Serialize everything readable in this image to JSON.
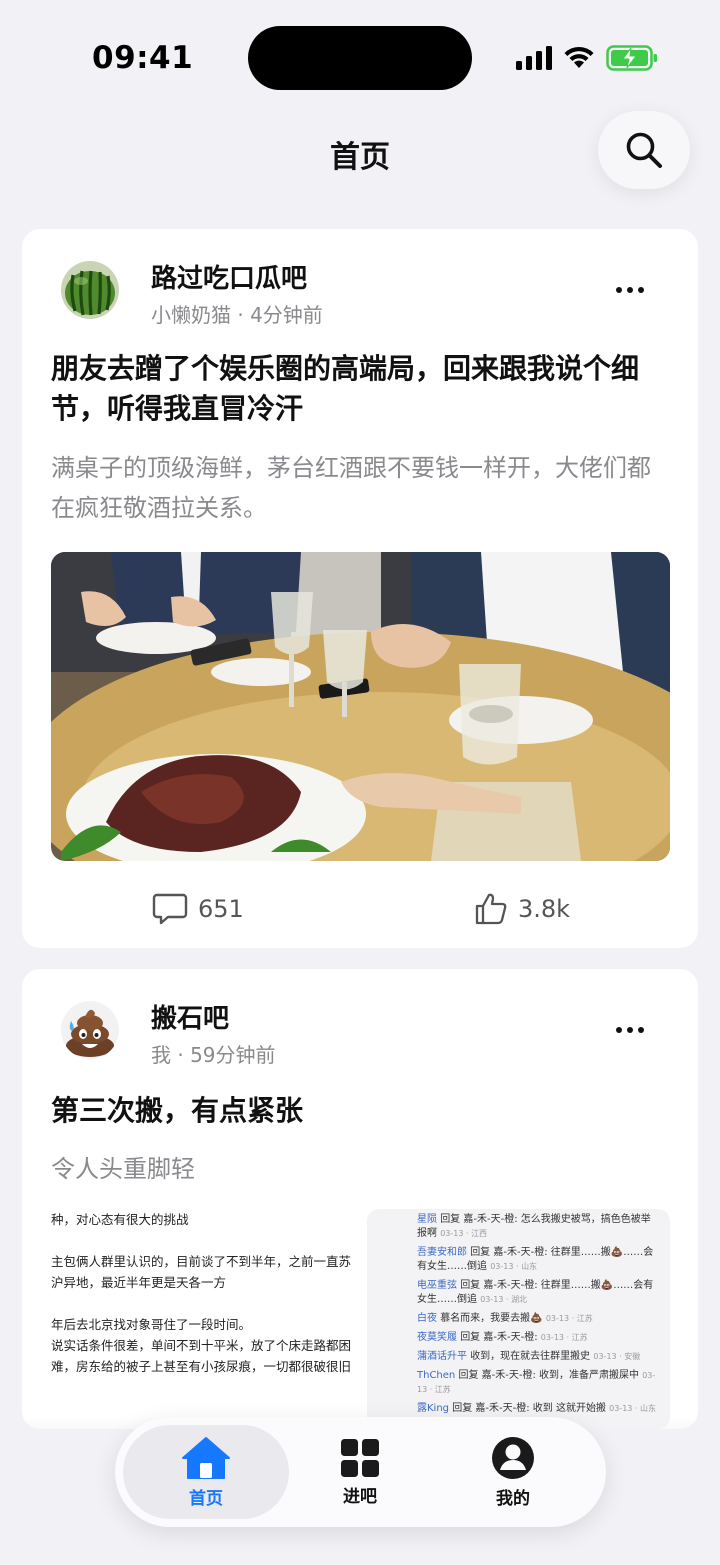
{
  "status_bar": {
    "time": "09:41"
  },
  "header": {
    "title": "首页"
  },
  "posts": [
    {
      "forum": "路过吃口瓜吧",
      "author": "小懒奶猫",
      "time": "4分钟前",
      "title": "朋友去蹭了个娱乐圈的高端局，回来跟我说个细节，听得我直冒冷汗",
      "excerpt": "满桌子的顶级海鲜，茅台红酒跟不要钱一样开，大佬们都在疯狂敬酒拉关系。",
      "comments": "651",
      "likes": "3.8k"
    },
    {
      "forum": "搬石吧",
      "author": "我",
      "time": "59分钟前",
      "title": "第三次搬，有点紧张",
      "excerpt": "令人头重脚轻",
      "image_left_text": [
        "种，对心态有很大的挑战",
        "主包俩人群里认识的，目前谈了不到半年，之前一直苏沪异地，最近半年更是天各一方",
        "年后去北京找对象哥住了一段时间。\n说实话条件很差，单间不到十平米，放了个床走路都困难，房东给的被子上甚至有小孩尿痕，一切都很破很旧"
      ],
      "image_right_comments": [
        {
          "user": "星陨",
          "text": "回复 嘉-禾-天-橙: 怎么我搬史被骂，搞色色被举报啊",
          "meta": "03-13 · 江西"
        },
        {
          "user": "吾妻安和郎",
          "text": "回复 嘉-禾-天-橙: 往群里……搬💩……会有女生……倒追",
          "meta": "03-13 · 山东"
        },
        {
          "user": "电巫重弦",
          "text": "回复 嘉-禾-天-橙: 往群里……搬💩……会有女生……倒追",
          "meta": "03-13 · 湖北"
        },
        {
          "user": "白夜",
          "text": "慕名而来，我要去搬💩",
          "meta": "03-13 · 江苏"
        },
        {
          "user": "夜莫笑履",
          "text": "回复 嘉-禾-天-橙:",
          "meta": "03-13 · 江苏"
        },
        {
          "user": "蒲酒话升平",
          "text": "收到，现在就去往群里搬史",
          "meta": "03-13 · 安徽"
        },
        {
          "user": "ThChen",
          "text": "回复 嘉-禾-天-橙: 收到，准备严肃搬屎中",
          "meta": "03-13 · 江苏"
        },
        {
          "user": "露King",
          "text": "回复 嘉-禾-天-橙: 收到 这就开始搬",
          "meta": "03-13 · 山东"
        }
      ]
    }
  ],
  "tabbar": {
    "tabs": [
      {
        "label": "首页",
        "icon": "home-icon",
        "active": true
      },
      {
        "label": "进吧",
        "icon": "grid-icon",
        "active": false
      },
      {
        "label": "我的",
        "icon": "profile-icon",
        "active": false
      }
    ]
  },
  "colors": {
    "accent": "#1677ff",
    "background": "#f2f2f6",
    "card": "#ffffff",
    "secondary_text": "#8a8a8e"
  }
}
